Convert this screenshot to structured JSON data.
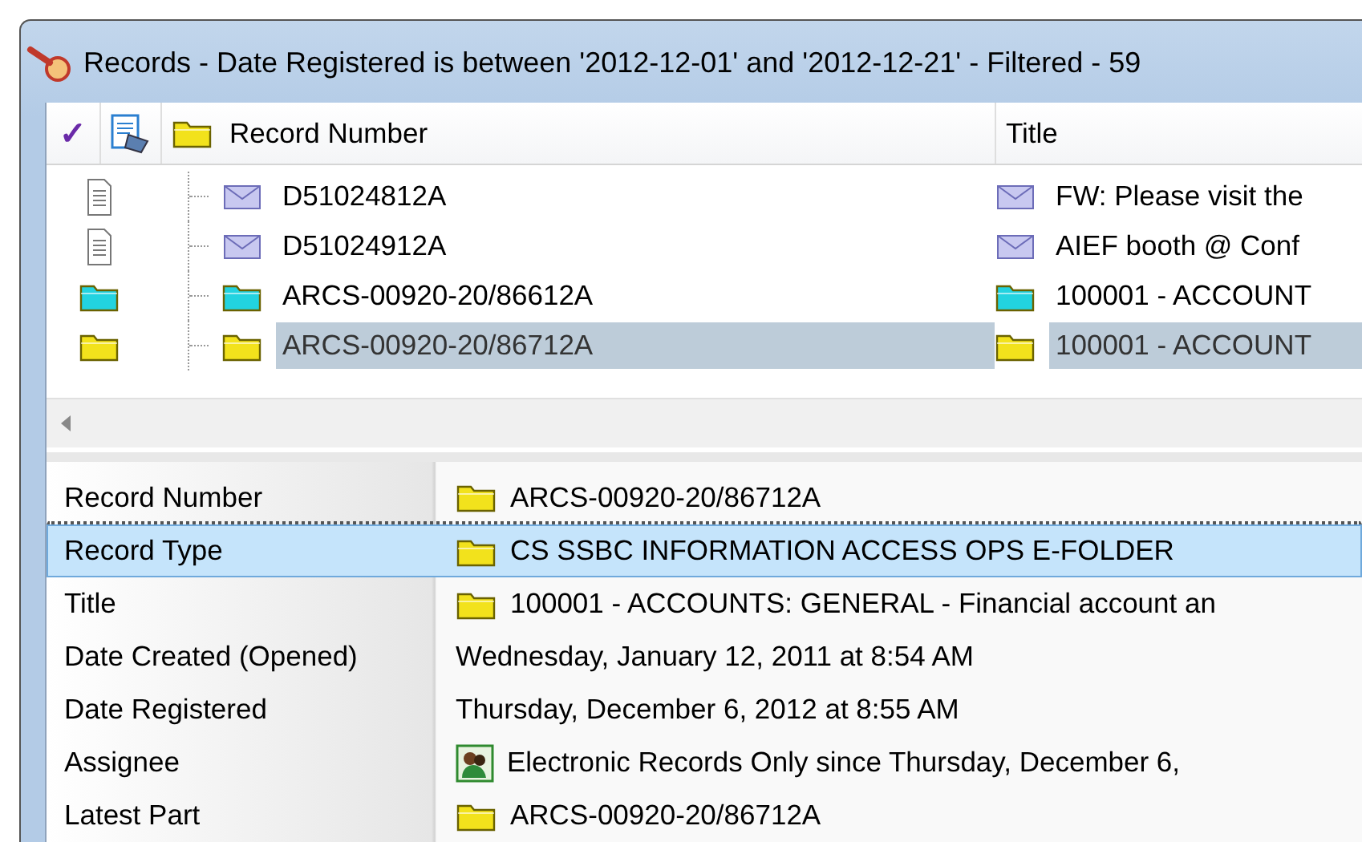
{
  "window": {
    "title": "Records - Date Registered is between '2012-12-01' and '2012-12-21' - Filtered - 59"
  },
  "list": {
    "columns": [
      {
        "kind": "check",
        "label": "✓"
      },
      {
        "kind": "type"
      },
      {
        "kind": "folder",
        "label": "Record Number"
      },
      {
        "kind": "text",
        "label": "Title"
      }
    ],
    "rows": [
      {
        "kind": "document",
        "record_number": "D51024812A",
        "title": "FW: Please visit the",
        "selected": false
      },
      {
        "kind": "document",
        "record_number": "D51024912A",
        "title": "AIEF booth @ Conf",
        "selected": false
      },
      {
        "kind": "folder",
        "color": "#22d3e0",
        "record_number": "ARCS-00920-20/86612A",
        "title": "100001 - ACCOUNT",
        "selected": false
      },
      {
        "kind": "folder",
        "color": "#f2e21c",
        "record_number": "ARCS-00920-20/86712A",
        "title": "100001 - ACCOUNT",
        "selected": true
      }
    ]
  },
  "properties": [
    {
      "kind": "folder",
      "label": "Record Number",
      "value": "ARCS-00920-20/86712A",
      "selected": false
    },
    {
      "kind": "folder",
      "label": "Record Type",
      "value": "CS SSBC INFORMATION ACCESS OPS E-FOLDER",
      "selected": true
    },
    {
      "kind": "folder",
      "label": "Title",
      "value": "100001 - ACCOUNTS: GENERAL - Financial account an",
      "selected": false
    },
    {
      "kind": "date",
      "label": "Date Created (Opened)",
      "value": "Wednesday, January 12, 2011 at 8:54 AM",
      "selected": false
    },
    {
      "kind": "date",
      "label": "Date Registered",
      "value": "Thursday, December 6, 2012 at 8:55 AM",
      "selected": false
    },
    {
      "kind": "location",
      "label": "Assignee",
      "value": "Electronic Records Only since Thursday, December 6,",
      "selected": false
    },
    {
      "kind": "folder",
      "label": "Latest Part",
      "value": "ARCS-00920-20/86712A",
      "selected": false
    }
  ]
}
